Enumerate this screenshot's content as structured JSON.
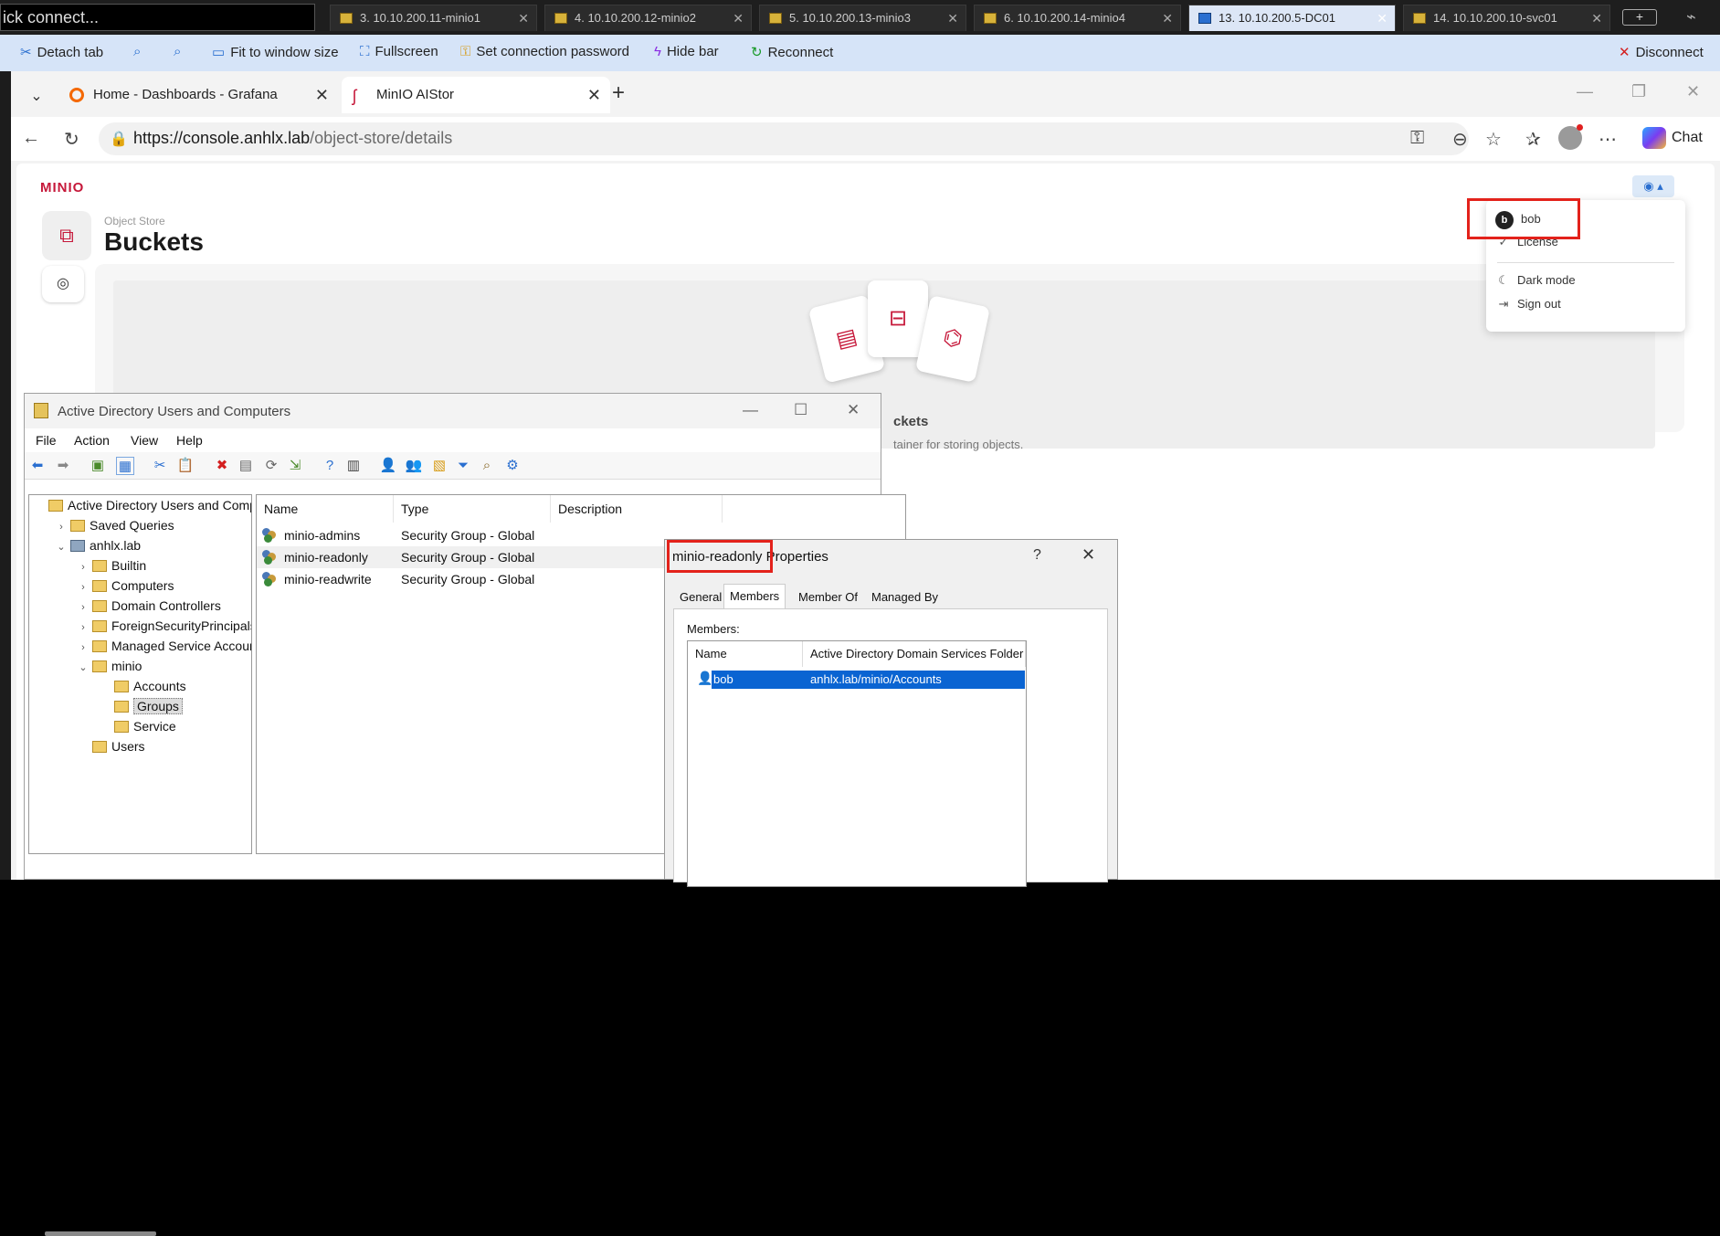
{
  "rdp": {
    "quick_connect": "ick connect...",
    "tabs": [
      {
        "label": "3. 10.10.200.11-minio1"
      },
      {
        "label": "4. 10.10.200.12-minio2"
      },
      {
        "label": "5. 10.10.200.13-minio3"
      },
      {
        "label": "6. 10.10.200.14-minio4"
      },
      {
        "label": "13. 10.10.200.5-DC01",
        "active": true
      },
      {
        "label": "14. 10.10.200.10-svc01"
      }
    ],
    "commands": {
      "detach": "Detach tab",
      "fit": "Fit to window size",
      "fullscreen": "Fullscreen",
      "password": "Set connection password",
      "hide": "Hide bar",
      "reconnect": "Reconnect",
      "disconnect": "Disconnect"
    }
  },
  "browser": {
    "tabs": [
      {
        "label": "Home - Dashboards - Grafana"
      },
      {
        "label": "MinIO AIStor",
        "active": true
      }
    ],
    "url_host": "https://console.anhlx.lab",
    "url_path": "/object-store/details",
    "chat_label": "Chat"
  },
  "minio": {
    "logo": "MINIO",
    "breadcrumb": "Object Store",
    "title": "Buckets",
    "empty_title": "ckets",
    "empty_text": "tainer for storing objects.",
    "user_menu": {
      "avatar_letter": "b",
      "username": "bob",
      "items": [
        "License",
        "Dark mode",
        "Sign out"
      ]
    }
  },
  "aduc": {
    "title": "Active Directory Users and Computers",
    "menu": [
      "File",
      "Action",
      "View",
      "Help"
    ],
    "tree": [
      {
        "label": "Active Directory Users and Comp",
        "level": 0,
        "expander": ""
      },
      {
        "label": "Saved Queries",
        "level": 1,
        "expander": ">"
      },
      {
        "label": "anhlx.lab",
        "level": 1,
        "expander": "v"
      },
      {
        "label": "Builtin",
        "level": 2,
        "expander": ">"
      },
      {
        "label": "Computers",
        "level": 2,
        "expander": ">"
      },
      {
        "label": "Domain Controllers",
        "level": 2,
        "expander": ">"
      },
      {
        "label": "ForeignSecurityPrincipals",
        "level": 2,
        "expander": ">"
      },
      {
        "label": "Managed Service Accoun",
        "level": 2,
        "expander": ">"
      },
      {
        "label": "minio",
        "level": 2,
        "expander": "v"
      },
      {
        "label": "Accounts",
        "level": 3,
        "expander": ""
      },
      {
        "label": "Groups",
        "level": 3,
        "expander": "",
        "selected": true
      },
      {
        "label": "Service",
        "level": 3,
        "expander": ""
      },
      {
        "label": "Users",
        "level": 2,
        "expander": ""
      }
    ],
    "columns": [
      "Name",
      "Type",
      "Description"
    ],
    "rows": [
      {
        "name": "minio-admins",
        "type": "Security Group - Global"
      },
      {
        "name": "minio-readonly",
        "type": "Security Group - Global"
      },
      {
        "name": "minio-readwrite",
        "type": "Security Group - Global"
      }
    ]
  },
  "props": {
    "title_group": "minio-readonly",
    "title_suffix": "Properties",
    "help": "?",
    "tabs": [
      "General",
      "Members",
      "Member Of",
      "Managed By"
    ],
    "active_tab": "Members",
    "members_label": "Members:",
    "columns": [
      "Name",
      "Active Directory Domain Services Folder"
    ],
    "members": [
      {
        "name": "bob",
        "folder": "anhlx.lab/minio/Accounts"
      }
    ]
  },
  "colors": {
    "minio_accent": "#c6183a",
    "selection": "#0a64d2",
    "highlight_box": "#e3221b"
  }
}
